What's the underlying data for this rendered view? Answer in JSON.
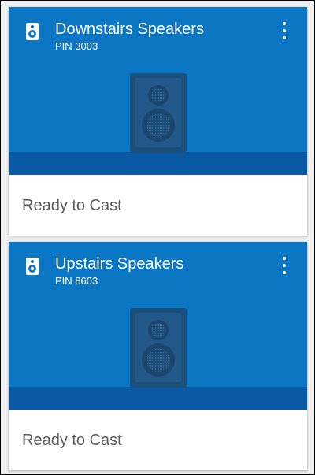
{
  "colors": {
    "card_blue": "#0b76c4",
    "floor_blue": "#0959a5",
    "speaker_dark": "#1d4f7b",
    "text_white": "#ffffff",
    "status_grey": "#5a5a5a"
  },
  "devices": [
    {
      "name": "Downstairs Speakers",
      "pin": "PIN 3003",
      "status": "Ready to Cast",
      "icon": "speaker-icon",
      "menu_icon": "more-vert-icon"
    },
    {
      "name": "Upstairs Speakers",
      "pin": "PIN 8603",
      "status": "Ready to Cast",
      "icon": "speaker-icon",
      "menu_icon": "more-vert-icon"
    }
  ]
}
